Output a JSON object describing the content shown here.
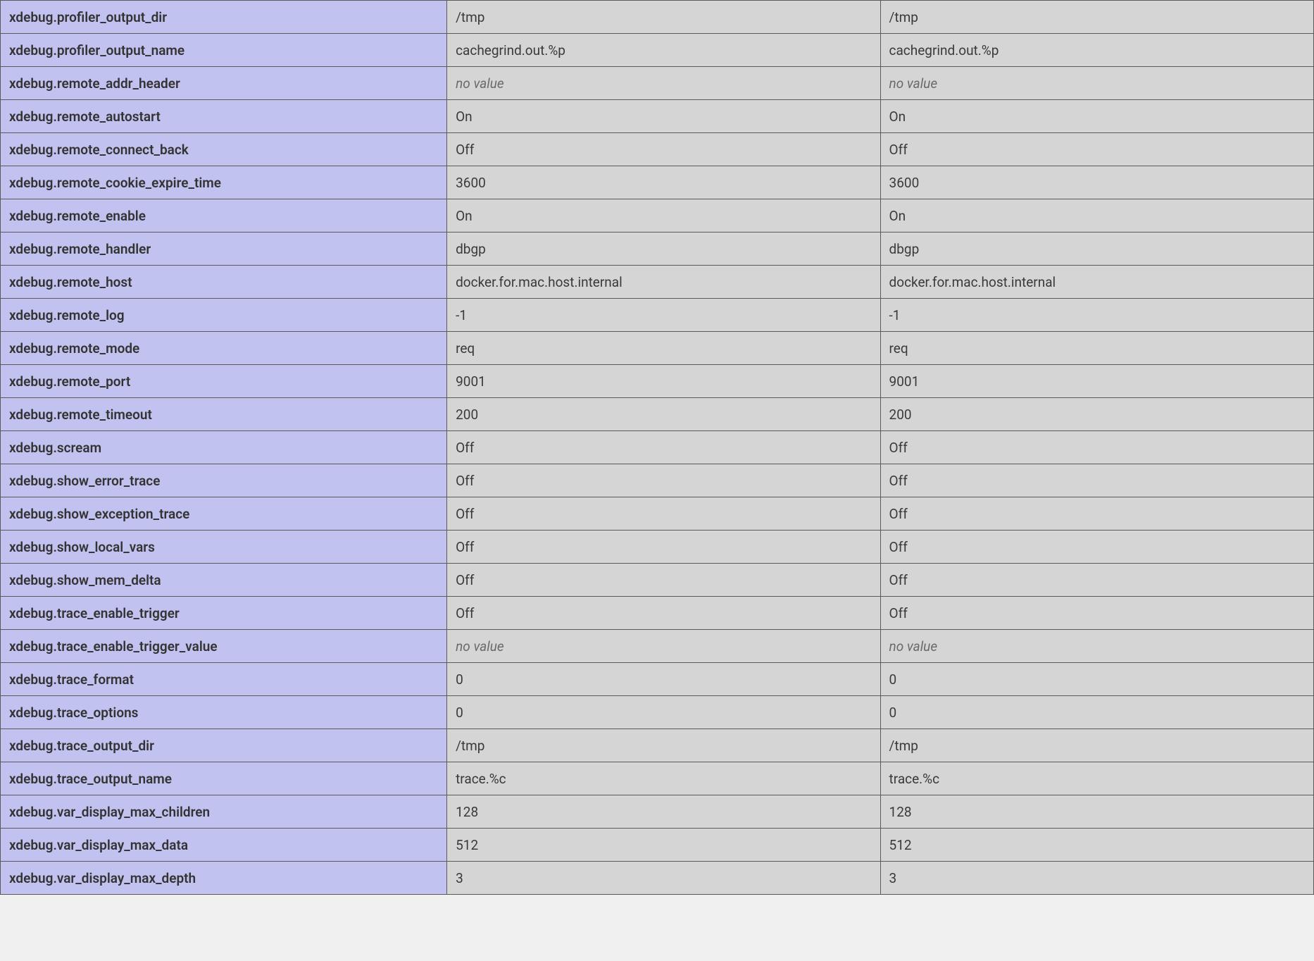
{
  "no_value_text": "no value",
  "rows": [
    {
      "directive": "xdebug.profiler_output_dir",
      "local": "/tmp",
      "master": "/tmp"
    },
    {
      "directive": "xdebug.profiler_output_name",
      "local": "cachegrind.out.%p",
      "master": "cachegrind.out.%p"
    },
    {
      "directive": "xdebug.remote_addr_header",
      "local": null,
      "master": null
    },
    {
      "directive": "xdebug.remote_autostart",
      "local": "On",
      "master": "On"
    },
    {
      "directive": "xdebug.remote_connect_back",
      "local": "Off",
      "master": "Off"
    },
    {
      "directive": "xdebug.remote_cookie_expire_time",
      "local": "3600",
      "master": "3600"
    },
    {
      "directive": "xdebug.remote_enable",
      "local": "On",
      "master": "On"
    },
    {
      "directive": "xdebug.remote_handler",
      "local": "dbgp",
      "master": "dbgp"
    },
    {
      "directive": "xdebug.remote_host",
      "local": "docker.for.mac.host.internal",
      "master": "docker.for.mac.host.internal"
    },
    {
      "directive": "xdebug.remote_log",
      "local": "-1",
      "master": "-1"
    },
    {
      "directive": "xdebug.remote_mode",
      "local": "req",
      "master": "req"
    },
    {
      "directive": "xdebug.remote_port",
      "local": "9001",
      "master": "9001"
    },
    {
      "directive": "xdebug.remote_timeout",
      "local": "200",
      "master": "200"
    },
    {
      "directive": "xdebug.scream",
      "local": "Off",
      "master": "Off"
    },
    {
      "directive": "xdebug.show_error_trace",
      "local": "Off",
      "master": "Off"
    },
    {
      "directive": "xdebug.show_exception_trace",
      "local": "Off",
      "master": "Off"
    },
    {
      "directive": "xdebug.show_local_vars",
      "local": "Off",
      "master": "Off"
    },
    {
      "directive": "xdebug.show_mem_delta",
      "local": "Off",
      "master": "Off"
    },
    {
      "directive": "xdebug.trace_enable_trigger",
      "local": "Off",
      "master": "Off"
    },
    {
      "directive": "xdebug.trace_enable_trigger_value",
      "local": null,
      "master": null
    },
    {
      "directive": "xdebug.trace_format",
      "local": "0",
      "master": "0"
    },
    {
      "directive": "xdebug.trace_options",
      "local": "0",
      "master": "0"
    },
    {
      "directive": "xdebug.trace_output_dir",
      "local": "/tmp",
      "master": "/tmp"
    },
    {
      "directive": "xdebug.trace_output_name",
      "local": "trace.%c",
      "master": "trace.%c"
    },
    {
      "directive": "xdebug.var_display_max_children",
      "local": "128",
      "master": "128"
    },
    {
      "directive": "xdebug.var_display_max_data",
      "local": "512",
      "master": "512"
    },
    {
      "directive": "xdebug.var_display_max_depth",
      "local": "3",
      "master": "3"
    }
  ]
}
